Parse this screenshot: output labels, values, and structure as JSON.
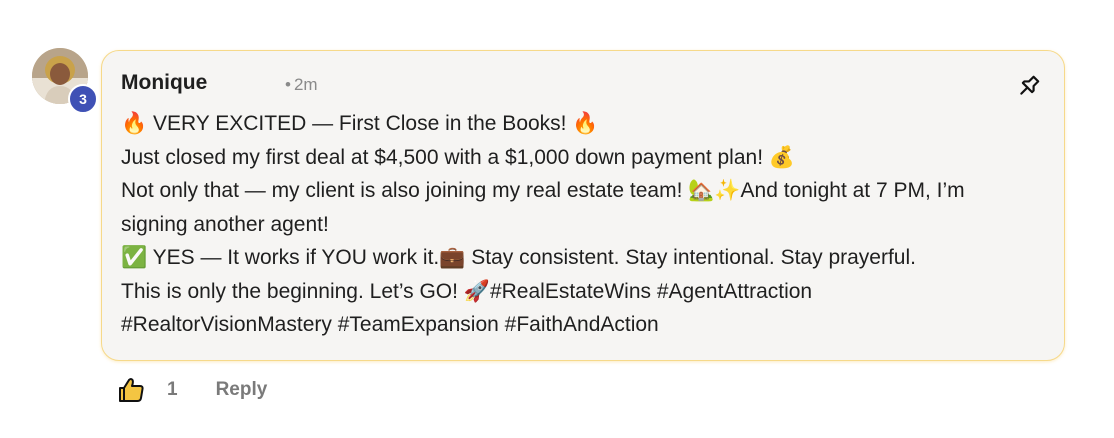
{
  "comment": {
    "author": "Monique",
    "time_separator": "•",
    "time": "2m",
    "author_level": "3",
    "pin_icon": "pin-icon",
    "body_lines": [
      "🔥 VERY EXCITED — First Close in the Books! 🔥",
      "Just closed my first deal at $4,500 with a $1,000 down payment plan! 💰",
      "Not only that — my client is also joining my real estate team! 🏡✨And tonight at 7 PM, I’m",
      "signing another agent!",
      "✅ YES — It works if YOU work it.💼 Stay consistent. Stay intentional. Stay prayerful.",
      "This is only the beginning. Let’s GO! 🚀#RealEstateWins #AgentAttraction",
      "#RealtorVisionMastery #TeamExpansion #FaithAndAction"
    ]
  },
  "actions": {
    "like_icon": "thumbs-up-icon",
    "like_count": "1",
    "reply_label": "Reply"
  },
  "colors": {
    "card_background": "#f6f5f3",
    "card_border": "#f6d98a",
    "level_badge": "#3f51b5",
    "muted_text": "#7a7a7a"
  }
}
